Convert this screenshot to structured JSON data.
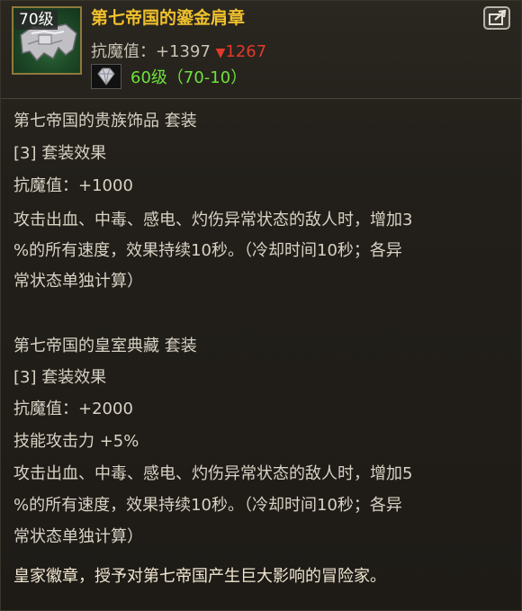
{
  "item": {
    "level_badge": "70级",
    "title": "第七帝国的鎏金肩章",
    "stat_line": "抗魔值：+1397 ",
    "stat_diff_arrow": "▼",
    "stat_diff_value": "1267",
    "grade_text": "60级（70-10）",
    "icon": "shoulder-armor-icon",
    "title_color": "#f0c12c",
    "grade_color": "#6fe23c",
    "diff_color": "#e23a2a"
  },
  "share_icon": "share-icon",
  "set_1": {
    "name": "第七帝国的贵族饰品  套装",
    "effect_header": "[3] 套装效果",
    "stat": "抗魔值：+1000",
    "desc_line_1": "攻击出血、中毒、感电、灼伤异常状态的敌人时，增加3",
    "desc_line_2": "%的所有速度，效果持续10秒。（冷却时间10秒；各异",
    "desc_line_3": "常状态单独计算）"
  },
  "set_2": {
    "name": "第七帝国的皇室典藏  套装",
    "effect_header": "[3] 套装效果",
    "stat": "抗魔值：+2000",
    "skill": "技能攻击力 +5%",
    "desc_line_1": "攻击出血、中毒、感电、灼伤异常状态的敌人时，增加5",
    "desc_line_2": "%的所有速度，效果持续10秒。（冷却时间10秒；各异",
    "desc_line_3": "常状态单独计算）"
  },
  "flavor_text": "皇家徽章，授予对第七帝国产生巨大影响的冒险家。"
}
